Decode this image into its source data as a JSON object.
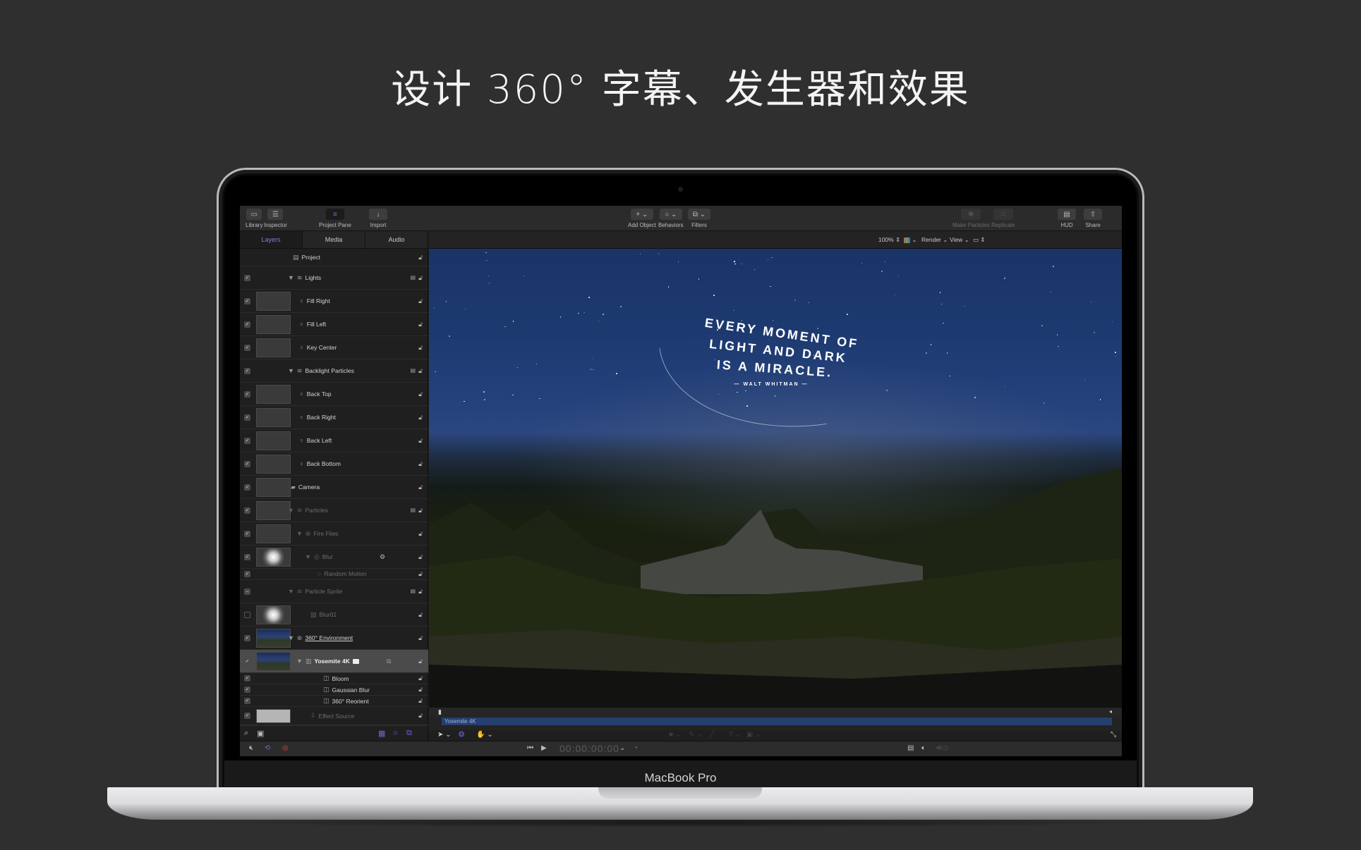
{
  "headline": "设计 360° 字幕、发生器和效果",
  "device_label": "MacBook Pro",
  "toolbar": {
    "library": "Library",
    "inspector": "Inspector",
    "project_pane": "Project Pane",
    "import": "Import",
    "add_object": "Add Object",
    "behaviors": "Behaviors",
    "filters": "Filters",
    "make_particles": "Make Particles",
    "replicate": "Replicate",
    "hud": "HUD",
    "share": "Share"
  },
  "tabs": [
    {
      "label": "Layers",
      "active": true
    },
    {
      "label": "Media",
      "active": false
    },
    {
      "label": "Audio",
      "active": false
    }
  ],
  "viewer_bar": {
    "zoom": "100%",
    "render": "Render",
    "view": "View"
  },
  "layers": [
    {
      "name": "Project",
      "checked": null,
      "icon": "document-icon"
    },
    {
      "name": "Lights",
      "checked": true,
      "icon": "group-icon"
    },
    {
      "name": "Fill Right",
      "checked": true,
      "icon": "light-icon"
    },
    {
      "name": "Fill Left",
      "checked": true,
      "icon": "light-icon"
    },
    {
      "name": "Key Center",
      "checked": true,
      "icon": "light-icon"
    },
    {
      "name": "Backlight Particles",
      "checked": true,
      "icon": "group-icon"
    },
    {
      "name": "Back Top",
      "checked": true,
      "icon": "light-icon"
    },
    {
      "name": "Back Right",
      "checked": true,
      "icon": "light-icon"
    },
    {
      "name": "Back Left",
      "checked": true,
      "icon": "light-icon"
    },
    {
      "name": "Back Bottom",
      "checked": true,
      "icon": "light-icon"
    },
    {
      "name": "Camera",
      "checked": true,
      "icon": "camera-icon"
    },
    {
      "name": "Particles",
      "checked": true,
      "icon": "group-icon"
    },
    {
      "name": "Fire Flies",
      "checked": true,
      "icon": "emitter-icon"
    },
    {
      "name": "Blur",
      "checked": true,
      "icon": "cell-icon"
    },
    {
      "name": "Random Motion",
      "checked": true,
      "icon": "behavior-icon"
    },
    {
      "name": "Particle Sprite",
      "checked": "mixed",
      "icon": "group-icon"
    },
    {
      "name": "Blur01",
      "checked": false,
      "icon": "image-icon"
    },
    {
      "name": "360° Environment",
      "checked": true,
      "icon": "environment-icon"
    },
    {
      "name": "Yosemite 4K",
      "checked": true,
      "icon": "film-icon",
      "selected": true
    },
    {
      "name": "Bloom",
      "checked": true,
      "icon": "filter-icon"
    },
    {
      "name": "Gaussian Blur",
      "checked": true,
      "icon": "filter-icon"
    },
    {
      "name": "360° Reorient",
      "checked": true,
      "icon": "filter-icon"
    },
    {
      "name": "Effect Source",
      "checked": true,
      "icon": "drop-zone-icon"
    }
  ],
  "viewer": {
    "quote_line1": "EVERY MOMENT OF",
    "quote_line2": "LIGHT AND DARK",
    "quote_line3": "IS A MIRACLE.",
    "attribution": "— WALT WHITMAN —"
  },
  "timeline": {
    "clip_label": "Yosemite 4K"
  },
  "transport": {
    "timecode": "00:00:00:00"
  },
  "colors": {
    "accent": "#6767e0",
    "record": "#e0463b",
    "clip": "#25406f"
  }
}
